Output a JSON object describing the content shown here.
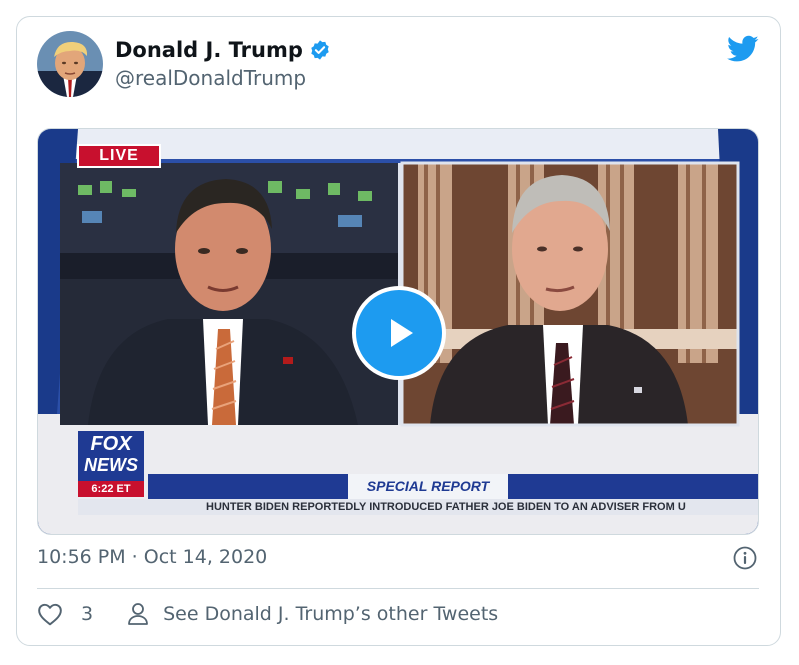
{
  "tweet": {
    "display_name": "Donald J. Trump",
    "handle": "@realDonaldTrump",
    "timestamp": "10:56 PM · Oct 14, 2020",
    "like_count": "3",
    "see_more_label": "See Donald J. Trump’s other Tweets"
  },
  "media": {
    "live_badge": "LIVE",
    "channel_logo_top": "FOX",
    "channel_logo_bottom": "NEWS",
    "channel_time": "6:22 ET",
    "program": "SPECIAL REPORT",
    "ticker": "HUNTER BIDEN REPORTEDLY INTRODUCED FATHER JOE BIDEN TO AN ADVISER FROM U"
  },
  "icons": {
    "verified": "verified-badge-icon",
    "twitter": "twitter-bird-icon",
    "play": "play-icon",
    "info": "info-icon",
    "like": "heart-icon",
    "profile": "person-icon"
  },
  "colors": {
    "accent": "#1d9bf0",
    "secondary_text": "#536471",
    "fox_red": "#c8102e",
    "fox_blue": "#1f3a93"
  }
}
